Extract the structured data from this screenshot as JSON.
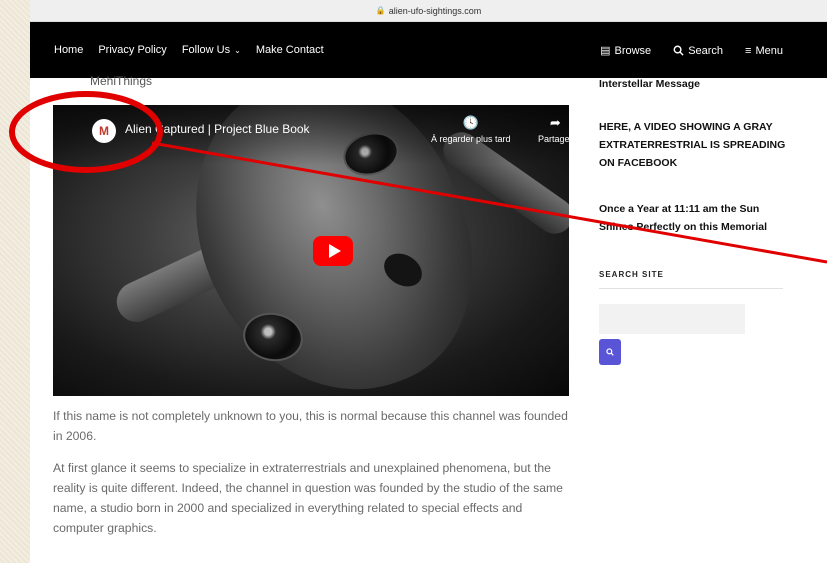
{
  "browser": {
    "url": "alien-ufo-sightings.com"
  },
  "nav": {
    "home": "Home",
    "privacy": "Privacy Policy",
    "follow": "Follow Us",
    "contact": "Make Contact",
    "browse": "Browse",
    "search": "Search",
    "menu": "Menu"
  },
  "article": {
    "cropped_line": "MehiThings",
    "paragraphs": [
      "If this name is not completely unknown to you, this is normal because this channel was founded in 2006.",
      "At first glance it seems to specialize in extraterrestrials and unexplained phenomena, but the reality is quite different. Indeed, the channel in question was founded by the studio of the same name, a studio born in 2000 and specialized in everything related to special effects and computer graphics."
    ]
  },
  "video": {
    "title": "Alien Captured | Project Blue Book",
    "watch_later": "À regarder plus tard",
    "share": "Partager"
  },
  "sidebar": {
    "links": [
      "Interstellar Message",
      "HERE, A VIDEO SHOWING A GRAY EXTRATERRESTRIAL IS SPREADING ON FACEBOOK",
      "Once a Year at 11:11 am the Sun Shines Perfectly on this Memorial"
    ],
    "search_heading": "SEARCH SITE",
    "search_placeholder": ""
  },
  "colors": {
    "nav_bg": "#000000",
    "play_red": "#ff0000",
    "search_button": "#5a55d6",
    "annotation_red": "#e00000"
  },
  "icons": {
    "lock": "lock-icon",
    "browse": "browse-icon",
    "search": "search-icon",
    "menu": "menu-icon",
    "clock": "clock-icon",
    "share": "share-icon",
    "play": "play-icon"
  }
}
